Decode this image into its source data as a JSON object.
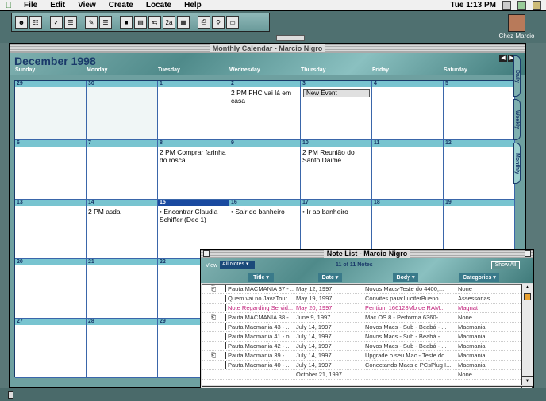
{
  "menubar": {
    "items": [
      "File",
      "Edit",
      "View",
      "Create",
      "Locate",
      "Help"
    ],
    "clock": "Tue 1:13 PM"
  },
  "toolbar": {
    "buttons": [
      {
        "icon": "contacts-icon"
      },
      {
        "icon": "contacts-book-icon"
      },
      {
        "icon": "task-icon"
      },
      {
        "icon": "task-list-icon"
      },
      {
        "icon": "note-icon"
      },
      {
        "icon": "note-list-icon"
      },
      {
        "icon": "calendar-day-icon"
      },
      {
        "icon": "calendar-week-icon"
      },
      {
        "icon": "calendar-span-icon"
      },
      {
        "icon": "calendar-2a-icon"
      },
      {
        "icon": "calendar-month-icon"
      },
      {
        "icon": "print-icon"
      },
      {
        "icon": "find-icon"
      },
      {
        "icon": "trash-icon"
      }
    ],
    "calendar_2a_label": "2a"
  },
  "desktop": {
    "icon_label": "Chez Marcio"
  },
  "calendar": {
    "window_title": "Monthly Calendar - Marcio Nigro",
    "month_title": "December 1998",
    "days": [
      "Sunday",
      "Monday",
      "Tuesday",
      "Wednesday",
      "Thursday",
      "Friday",
      "Saturday"
    ],
    "side_tabs": [
      "Daily",
      "Weekly",
      "Monthly"
    ],
    "weeks": [
      [
        {
          "n": "29",
          "out": true
        },
        {
          "n": "30",
          "out": true
        },
        {
          "n": "1"
        },
        {
          "n": "2",
          "ev": "2 PM FHC vai lá em casa"
        },
        {
          "n": "3",
          "new_event": "New Event"
        },
        {
          "n": "4"
        },
        {
          "n": "5"
        }
      ],
      [
        {
          "n": "6"
        },
        {
          "n": "7"
        },
        {
          "n": "8",
          "ev": "2 PM Comprar farinha do rosca"
        },
        {
          "n": "9"
        },
        {
          "n": "10",
          "ev": "2 PM Reunião do Santo Daime"
        },
        {
          "n": "11"
        },
        {
          "n": "12"
        }
      ],
      [
        {
          "n": "13"
        },
        {
          "n": "14",
          "ev": "2 PM asda"
        },
        {
          "n": "15",
          "today": true,
          "ev": "• Encontrar Claudia Schiffer (Dec 1)"
        },
        {
          "n": "16",
          "ev": "• Sair do banheiro"
        },
        {
          "n": "17",
          "ev": "• Ir ao banheiro"
        },
        {
          "n": "18"
        },
        {
          "n": "19"
        }
      ],
      [
        {
          "n": "20"
        },
        {
          "n": "21"
        },
        {
          "n": "22"
        },
        {
          "n": ""
        },
        {
          "n": ""
        },
        {
          "n": ""
        },
        {
          "n": ""
        }
      ],
      [
        {
          "n": "27"
        },
        {
          "n": "28"
        },
        {
          "n": "29"
        },
        {
          "n": ""
        },
        {
          "n": ""
        },
        {
          "n": ""
        },
        {
          "n": ""
        }
      ]
    ]
  },
  "notes": {
    "window_title": "Note List - Marcio Nigro",
    "view_label": "View",
    "view_value": "All Notes",
    "count": "11 of 11 Notes",
    "show_all": "Show All",
    "columns": [
      "Title",
      "Date",
      "Body",
      "Categories"
    ],
    "rows": [
      {
        "icon": true,
        "title": "Pauta MACMANIA 37 - ...",
        "date": "May 12, 1997",
        "body": "Novos Macs-Teste do 4400,...",
        "cat": "None"
      },
      {
        "icon": false,
        "title": "Quem vai no JavaTour",
        "date": "May 19, 1997",
        "body": "Convites para:LuciferBueno...",
        "cat": "Assessorias"
      },
      {
        "icon": false,
        "pink": true,
        "title": "Note Regarding Servid...",
        "date": "May 20, 1997",
        "body": "Pentium 166128Mb de RAM...",
        "cat": "Magnat"
      },
      {
        "icon": true,
        "title": "Pauta MACMANIA 38 - ...",
        "date": "June 9, 1997",
        "body": "Mac OS 8 - Performa 6360-...",
        "cat": "None"
      },
      {
        "icon": false,
        "title": "Pauta Macmania 43 - ...",
        "date": "July 14, 1997",
        "body": "Novos Macs - Sub - Beabá - ...",
        "cat": "Macmania"
      },
      {
        "icon": false,
        "title": "Pauta Macmania 41 - o...",
        "date": "July 14, 1997",
        "body": "Novos Macs - Sub - Beabá - ...",
        "cat": "Macmania"
      },
      {
        "icon": false,
        "title": "Pauta Macmania 42 - ...",
        "date": "July 14, 1997",
        "body": "Novos Macs - Sub - Beabá - ...",
        "cat": "Macmania"
      },
      {
        "icon": true,
        "title": "Pauta Macmania 39 - ...",
        "date": "July 14, 1997",
        "body": "Upgrade o seu Mac - Teste do...",
        "cat": "Macmania"
      },
      {
        "icon": false,
        "title": "Pauta Macmania 40 - ...",
        "date": "July 14, 1997",
        "body": "Conectando Macs e PCsPlug I...",
        "cat": "Macmania"
      },
      {
        "icon": false,
        "title": "",
        "date": "October 21, 1997",
        "body": "",
        "cat": "None"
      }
    ]
  },
  "colors": {
    "accent": "#1a4aa0",
    "cell_header": "#78c4d0",
    "pink": "#c0207a"
  }
}
